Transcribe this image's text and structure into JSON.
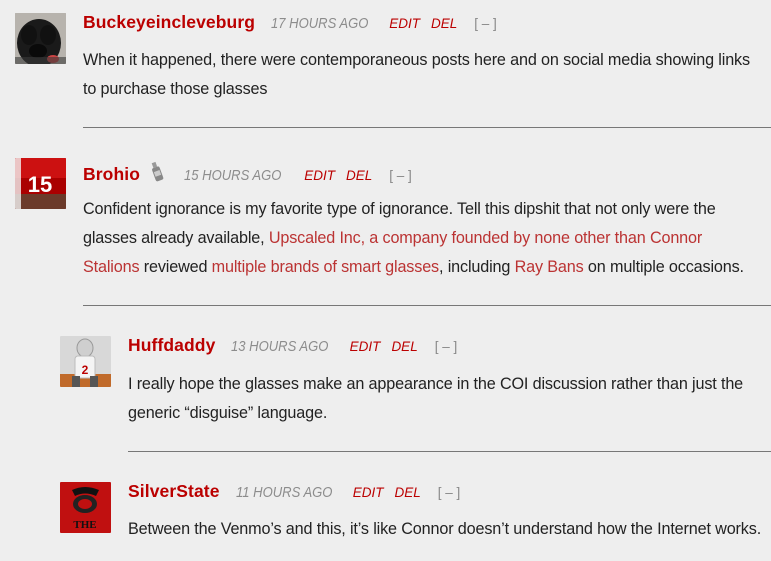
{
  "comments": [
    {
      "author": "Buckeyeincleveburg",
      "time": "17 HOURS AGO",
      "edit": "EDIT",
      "del": "DEL",
      "collapse": "[ – ]",
      "text": "When it happened, there were contemporaneous posts here and on social media showing links to purchase those glasses"
    },
    {
      "author": "Brohio",
      "badge_icon": "bottle-icon",
      "time": "15 HOURS AGO",
      "edit": "EDIT",
      "del": "DEL",
      "collapse": "[ – ]",
      "text_parts": {
        "p1": "Confident ignorance is my favorite type of ignorance. Tell this dipshit that not only were the glasses already available, ",
        "link1": "Upscaled Inc, a company founded by none other than Connor Stalions",
        "p2": " reviewed ",
        "link2": "multiple brands of smart glasses",
        "p3": ", including ",
        "link3": "Ray Bans",
        "p4": " on multiple occasions."
      }
    },
    {
      "author": "Huffdaddy",
      "time": "13 HOURS AGO",
      "edit": "EDIT",
      "del": "DEL",
      "collapse": "[ – ]",
      "text": "I really hope the glasses make an appearance in the COI discussion rather than just the generic “disguise” language."
    },
    {
      "author": "SilverState",
      "avatar_text": "THE",
      "time": "11 HOURS AGO",
      "edit": "EDIT",
      "del": "DEL",
      "collapse": "[ – ]",
      "text": "Between the Venmo’s and this, it’s like Connor doesn’t understand how the Internet works."
    }
  ],
  "colors": {
    "background": "#eeeeee",
    "author": "#bb0000",
    "link": "#bb3333",
    "timestamp": "#8c8c8c",
    "divider": "#777777"
  },
  "brohio_avatar_number": "15"
}
